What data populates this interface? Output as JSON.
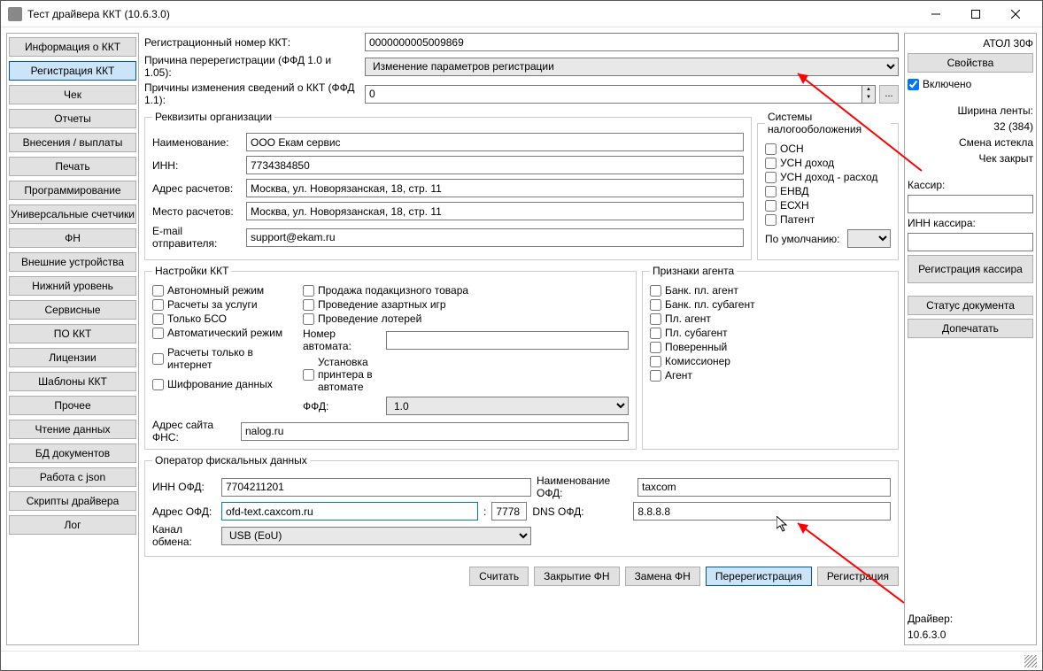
{
  "window": {
    "title": "Тест драйвера ККТ (10.6.3.0)"
  },
  "nav": {
    "info": "Информация о ККТ",
    "reg": "Регистрация ККТ",
    "check": "Чек",
    "reports": "Отчеты",
    "deposits": "Внесения / выплаты",
    "print": "Печать",
    "programming": "Программирование",
    "counters": "Универсальные счетчики",
    "fn": "ФН",
    "ext": "Внешние устройства",
    "low": "Нижний уровень",
    "service": "Сервисные",
    "software": "ПО ККТ",
    "licenses": "Лицензии",
    "templates": "Шаблоны ККТ",
    "other": "Прочее",
    "readdata": "Чтение данных",
    "bddoc": "БД документов",
    "json": "Работа с json",
    "scripts": "Скрипты драйвера",
    "log": "Лог"
  },
  "top": {
    "regnum_label": "Регистрационный номер ККТ:",
    "regnum_value": "0000000005009869",
    "reason_label": "Причина перерегистрации (ФФД 1.0 и 1.05):",
    "reason_value": "Изменение параметров регистрации",
    "changes_label": "Причины изменения сведений о ККТ (ФФД 1.1):",
    "changes_value": "0"
  },
  "org": {
    "legend": "Реквизиты организации",
    "name_label": "Наименование:",
    "name_value": "ООО Екам сервис",
    "inn_label": "ИНН:",
    "inn_value": "7734384850",
    "addr_label": "Адрес расчетов:",
    "addr_value": "Москва, ул. Новорязанская, 18, стр. 11",
    "place_label": "Место расчетов:",
    "place_value": "Москва, ул. Новорязанская, 18, стр. 11",
    "email_label": "E-mail отправителя:",
    "email_value": "support@ekam.ru"
  },
  "tax": {
    "legend": "Системы налогооболожения",
    "osn": "ОСН",
    "usn_d": "УСН доход",
    "usn_dr": "УСН доход - расход",
    "envd": "ЕНВД",
    "esxn": "ЕСХН",
    "patent": "Патент",
    "default_label": "По умолчанию:"
  },
  "kkt": {
    "legend": "Настройки ККТ",
    "autonomous": "Автономный режим",
    "services": "Расчеты за услуги",
    "bso": "Только БСО",
    "auto": "Автоматический режим",
    "internet": "Расчеты только в интернет",
    "encrypt": "Шифрование данных",
    "excise": "Продажа подакцизного товара",
    "gambling": "Проведение азартных игр",
    "lottery": "Проведение лотерей",
    "machine_label": "Номер автомата:",
    "printer": "Установка принтера в автомате",
    "ffd_label": "ФФД:",
    "ffd_value": "1.0",
    "fns_label": "Адрес сайта ФНС:",
    "fns_value": "nalog.ru"
  },
  "agent": {
    "legend": "Признаки агента",
    "bank_agent": "Банк. пл. агент",
    "bank_sub": "Банк. пл. субагент",
    "pay_agent": "Пл. агент",
    "pay_sub": "Пл. субагент",
    "attorney": "Поверенный",
    "commissioner": "Комиссионер",
    "agent_lbl": "Агент"
  },
  "ofd": {
    "legend": "Оператор фискальных данных",
    "inn_label": "ИНН ОФД:",
    "inn_value": "7704211201",
    "name_label": "Наименование ОФД:",
    "name_value": "taxcom",
    "addr_label": "Адрес ОФД:",
    "addr_value": "ofd-text.caxcom.ru",
    "port_value": "7778",
    "dns_label": "DNS ОФД:",
    "dns_value": "8.8.8.8",
    "channel_label": "Канал обмена:",
    "channel_value": "USB (EoU)"
  },
  "actions": {
    "read": "Считать",
    "close_fn": "Закрытие ФН",
    "replace_fn": "Замена ФН",
    "rereg": "Перерегистрация",
    "reg": "Регистрация"
  },
  "right": {
    "model": "АТОЛ 30Ф",
    "props": "Свойства",
    "enabled": "Включено",
    "tape_label": "Ширина ленты:",
    "tape_value": "32 (384)",
    "shift": "Смена истекла",
    "check_status": "Чек закрыт",
    "cashier_label": "Кассир:",
    "cashier_inn_label": "ИНН кассира:",
    "reg_cashier": "Регистрация кассира",
    "doc_status": "Статус документа",
    "reprint": "Допечатать",
    "driver_label": "Драйвер:",
    "driver_ver": "10.6.3.0"
  }
}
